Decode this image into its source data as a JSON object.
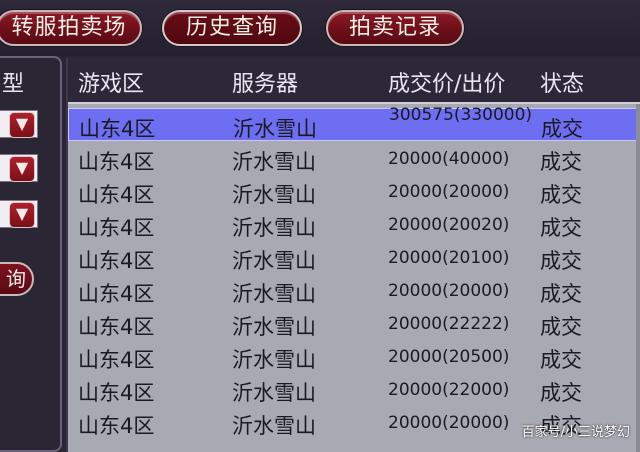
{
  "tabs": [
    {
      "label": "转服拍卖场"
    },
    {
      "label": "历史查询"
    },
    {
      "label": "拍卖记录"
    }
  ],
  "left_panel": {
    "label": "型",
    "dropdown_arrow": "▼",
    "query_button": "询"
  },
  "table": {
    "headers": [
      "游戏区",
      "服务器",
      "成交价/出价",
      "状态"
    ],
    "rows": [
      {
        "zone": "山东4区",
        "server": "沂水雪山",
        "price": "300575(330000)",
        "status": "成交",
        "selected": true
      },
      {
        "zone": "山东4区",
        "server": "沂水雪山",
        "price": "20000(40000)",
        "status": "成交"
      },
      {
        "zone": "山东4区",
        "server": "沂水雪山",
        "price": "20000(20000)",
        "status": "成交"
      },
      {
        "zone": "山东4区",
        "server": "沂水雪山",
        "price": "20000(20020)",
        "status": "成交"
      },
      {
        "zone": "山东4区",
        "server": "沂水雪山",
        "price": "20000(20100)",
        "status": "成交"
      },
      {
        "zone": "山东4区",
        "server": "沂水雪山",
        "price": "20000(20000)",
        "status": "成交"
      },
      {
        "zone": "山东4区",
        "server": "沂水雪山",
        "price": "20000(22222)",
        "status": "成交"
      },
      {
        "zone": "山东4区",
        "server": "沂水雪山",
        "price": "20000(20500)",
        "status": "成交"
      },
      {
        "zone": "山东4区",
        "server": "沂水雪山",
        "price": "20000(22000)",
        "status": "成交"
      },
      {
        "zone": "山东4区",
        "server": "沂水雪山",
        "price": "20000(20000)",
        "status": "成交"
      }
    ]
  },
  "watermark": "百家号/小三说梦幻",
  "colors": {
    "tab_red": "#7a1220",
    "selected_row": "#6e6ef2",
    "table_bg": "#a8aab3",
    "header_bg": "#2c2838"
  }
}
